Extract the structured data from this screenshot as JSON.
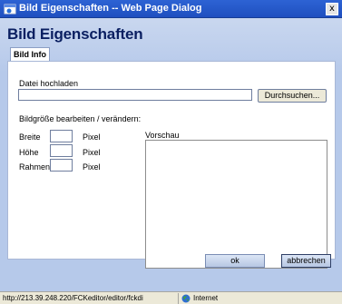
{
  "window": {
    "title": "Bild Eigenschaften -- Web Page Dialog",
    "close_label": "x"
  },
  "dialog": {
    "heading": "Bild Eigenschaften",
    "tabs": [
      {
        "label": "Bild Info",
        "selected": true
      }
    ]
  },
  "upload": {
    "label": "Datei hochladen",
    "value": "",
    "browse_label": "Durchsuchen..."
  },
  "size_section": {
    "label": "Bildgröße bearbeiten / verändern:",
    "fields": [
      {
        "label": "Breite",
        "value": "",
        "unit": "Pixel"
      },
      {
        "label": "Höhe",
        "value": "",
        "unit": "Pixel"
      },
      {
        "label": "Rahmen",
        "value": "",
        "unit": "Pixel"
      }
    ]
  },
  "preview": {
    "label": "Vorschau"
  },
  "buttons": {
    "ok": "ok",
    "cancel": "abbrechen"
  },
  "statusbar": {
    "url": "http://213.39.248.220/FCKeditor/editor/fckdi",
    "zone": "Internet"
  },
  "colors": {
    "titlebar": "#2d63d4",
    "dialog_bg": "#b6c9ea",
    "heading": "#0a1f61"
  },
  "icons": {
    "window": "ie-dialog-icon",
    "zone": "globe-icon"
  }
}
